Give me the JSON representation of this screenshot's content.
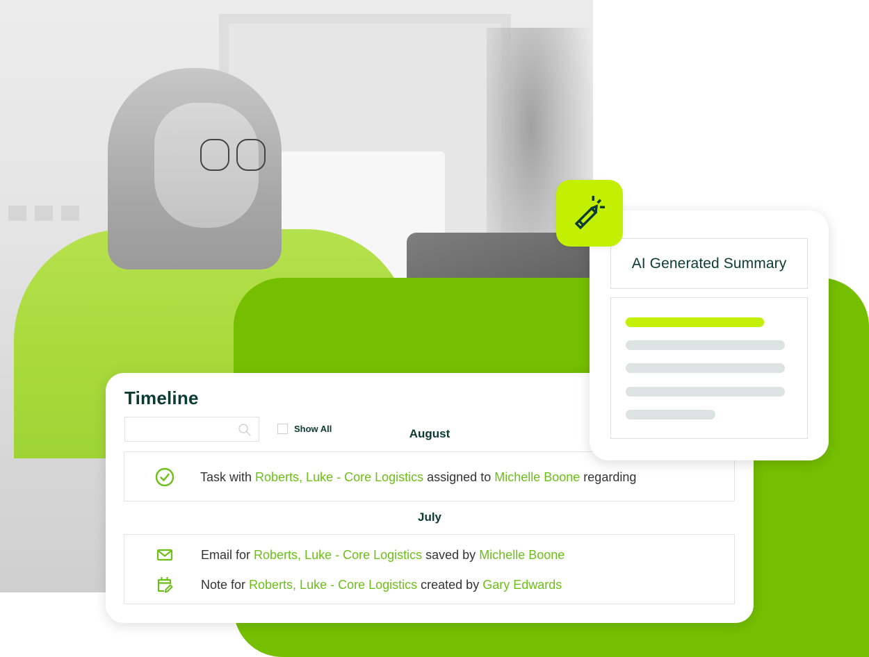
{
  "timeline": {
    "title": "Timeline",
    "search": {
      "value": "",
      "placeholder": ""
    },
    "show_all": {
      "label": "Show All",
      "checked": false
    },
    "groups": [
      {
        "month": "August",
        "items": [
          {
            "icon": "check-circle-icon",
            "parts": [
              "Task with ",
              "Roberts, Luke - Core Logistics",
              " assigned to ",
              "Michelle Boone",
              " regarding"
            ]
          }
        ]
      },
      {
        "month": "July",
        "items": [
          {
            "icon": "mail-icon",
            "parts": [
              "Email for ",
              "Roberts, Luke - Core Logistics",
              " saved by ",
              "Michelle Boone"
            ]
          },
          {
            "icon": "calendar-edit-icon",
            "parts": [
              "Note for ",
              "Roberts, Luke - Core Logistics",
              " created by ",
              "Gary Edwards"
            ]
          }
        ]
      }
    ]
  },
  "ai_summary": {
    "title": "AI Generated Summary",
    "badge_icon": "magic-pencil-icon",
    "placeholder_lines": 5
  },
  "colors": {
    "brand_dark": "#0b3b32",
    "link_green": "#6cbf18",
    "accent_lime": "#c3f000",
    "backdrop_green": "#75bf00",
    "placeholder_gray": "#dde3e2"
  }
}
